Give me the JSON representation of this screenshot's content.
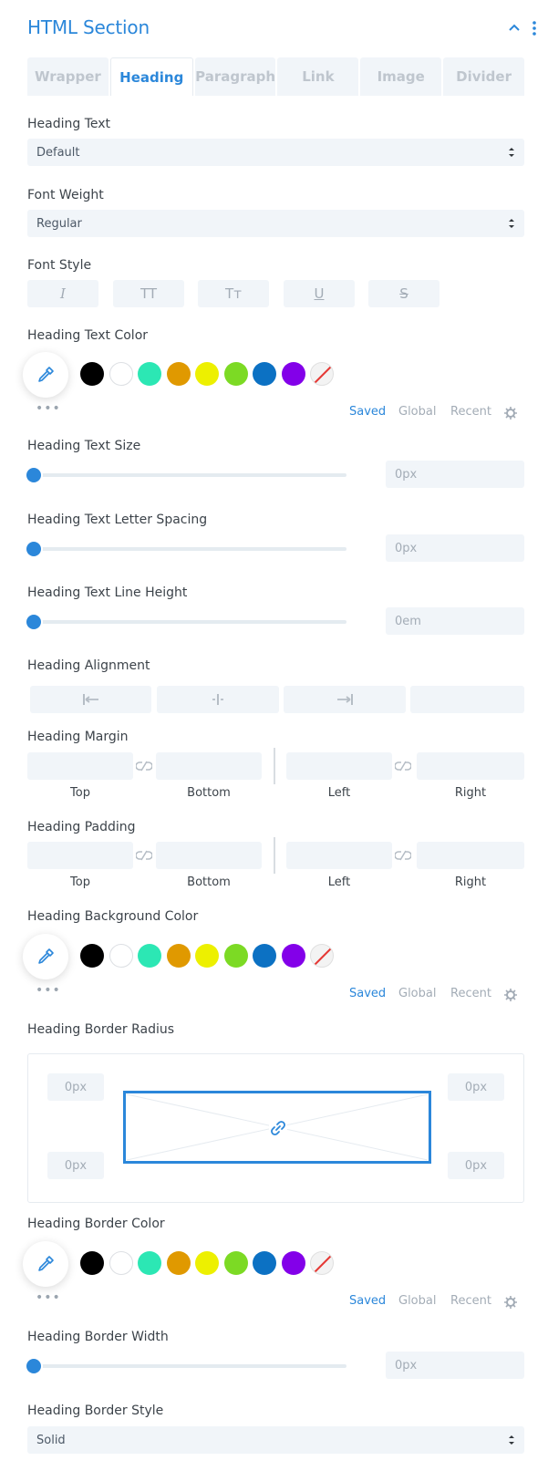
{
  "header": {
    "title": "HTML Section"
  },
  "tabs": [
    "Wrapper",
    "Heading",
    "Paragraph",
    "Link",
    "Image",
    "Divider"
  ],
  "heading_text": {
    "label": "Heading Text",
    "value": "Default"
  },
  "font_weight": {
    "label": "Font Weight",
    "value": "Regular"
  },
  "font_style": {
    "label": "Font Style",
    "buttons": [
      "I",
      "TT",
      "Tт",
      "U",
      "S"
    ]
  },
  "text_color": {
    "label": "Heading Text Color"
  },
  "swatches": [
    "#000000",
    "#ffffff",
    "#2ce7b4",
    "#e09900",
    "#edf000",
    "#7cda24",
    "#0c71c3",
    "#8300e9"
  ],
  "color_tabs": {
    "saved": "Saved",
    "global": "Global",
    "recent": "Recent",
    "more": "•••"
  },
  "text_size": {
    "label": "Heading Text Size",
    "value": "0px"
  },
  "letter_spacing": {
    "label": "Heading Text Letter Spacing",
    "value": "0px"
  },
  "line_height": {
    "label": "Heading Text Line Height",
    "value": "0em"
  },
  "alignment": {
    "label": "Heading Alignment"
  },
  "margin": {
    "label": "Heading Margin"
  },
  "padding": {
    "label": "Heading Padding"
  },
  "sides": {
    "top": "Top",
    "bottom": "Bottom",
    "left": "Left",
    "right": "Right"
  },
  "bg_color": {
    "label": "Heading Background Color"
  },
  "border_radius": {
    "label": "Heading Border Radius",
    "tl": "0px",
    "tr": "0px",
    "bl": "0px",
    "br": "0px"
  },
  "border_color": {
    "label": "Heading Border Color"
  },
  "border_width": {
    "label": "Heading Border Width",
    "value": "0px"
  },
  "border_style": {
    "label": "Heading Border Style",
    "value": "Solid"
  }
}
